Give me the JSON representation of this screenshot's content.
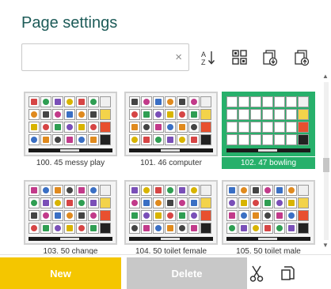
{
  "title": "Page settings",
  "search": {
    "value": "",
    "clear_glyph": "×"
  },
  "toolbar": [
    {
      "name": "sort-az-icon"
    },
    {
      "name": "grid-view-icon"
    },
    {
      "name": "import-page-icon"
    },
    {
      "name": "export-page-icon"
    }
  ],
  "pages": [
    {
      "label": "100. 45 messy play",
      "selected": false
    },
    {
      "label": "101. 46 computer",
      "selected": false
    },
    {
      "label": "102. 47 bowling",
      "selected": true
    },
    {
      "label": "103. 50 change",
      "selected": false
    },
    {
      "label": "104. 50 toilet female",
      "selected": false
    },
    {
      "label": "105. 50 toilet male",
      "selected": false
    }
  ],
  "buttons": {
    "new_label": "New",
    "delete_label": "Delete"
  },
  "actions": [
    {
      "name": "scissors-icon"
    },
    {
      "name": "copy-icon"
    }
  ],
  "colors": {
    "accent": "#1d5b58",
    "selected": "#27b06b",
    "new_button": "#f4c600",
    "delete_button": "#c8c8c8"
  }
}
